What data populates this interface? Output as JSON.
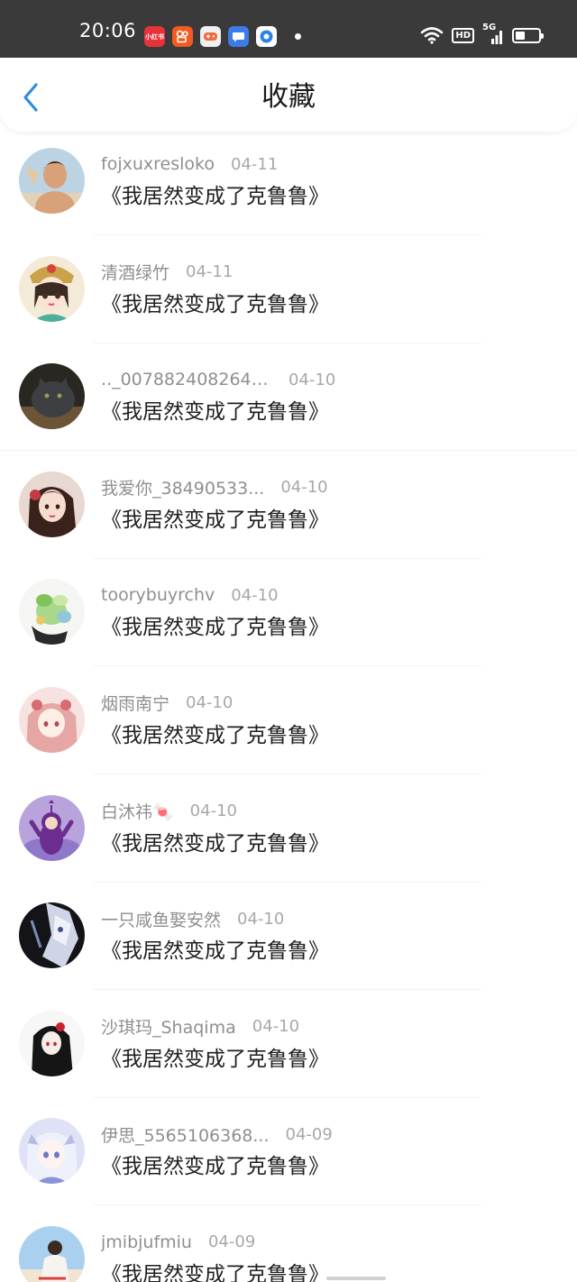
{
  "status_bar": {
    "time": "20:06",
    "notifications": [
      {
        "icon": "xiaohongshu-icon",
        "label": "小红书",
        "color": "#e8323a"
      },
      {
        "icon": "kuaishou-icon",
        "label": "",
        "color": "#f25a1f"
      },
      {
        "icon": "game-center-icon",
        "label": "",
        "color": "#f0f0f0"
      },
      {
        "icon": "message-icon",
        "label": "",
        "color": "#3d7be8"
      },
      {
        "icon": "app-store-icon",
        "label": "",
        "color": "#2a83e6"
      }
    ],
    "hd_label": "HD",
    "network_label": "5G"
  },
  "header": {
    "title": "收藏"
  },
  "favorites": [
    {
      "username": "fojxuxresloko",
      "date": "04-11",
      "book": "《我居然变成了克鲁鲁》",
      "avatar": "boy-avatar"
    },
    {
      "username": "清酒绿竹",
      "date": "04-11",
      "book": "《我居然变成了克鲁鲁》",
      "avatar": "anime-girl-avatar"
    },
    {
      "username": ".._0078824082644...",
      "date": "04-10",
      "book": "《我居然变成了克鲁鲁》",
      "avatar": "cat-avatar"
    },
    {
      "username": "我爱你_38490533...",
      "date": "04-10",
      "book": "《我居然变成了克鲁鲁》",
      "avatar": "girl-photo-avatar"
    },
    {
      "username": "toorybuyrchv",
      "date": "04-10",
      "book": "《我居然变成了克鲁鲁》",
      "avatar": "plant-avatar"
    },
    {
      "username": "烟雨南宁",
      "date": "04-10",
      "book": "《我居然变成了克鲁鲁》",
      "avatar": "pink-anime-avatar"
    },
    {
      "username": "白沐祎🍬",
      "date": "04-10",
      "book": "《我居然变成了克鲁鲁》",
      "avatar": "teletubby-avatar"
    },
    {
      "username": "一只咸鱼娶安然",
      "date": "04-10",
      "book": "《我居然变成了克鲁鲁》",
      "avatar": "dark-anime-avatar"
    },
    {
      "username": "沙琪玛_Shaqima",
      "date": "04-10",
      "book": "《我居然变成了克鲁鲁》",
      "avatar": "gothic-anime-avatar"
    },
    {
      "username": "伊思_5565106368...",
      "date": "04-09",
      "book": "《我居然变成了克鲁鲁》",
      "avatar": "lavender-anime-avatar"
    },
    {
      "username": "jmibjufmiu",
      "date": "04-09",
      "book": "《我居然变成了克鲁鲁》",
      "avatar": "sky-photo-avatar"
    }
  ]
}
